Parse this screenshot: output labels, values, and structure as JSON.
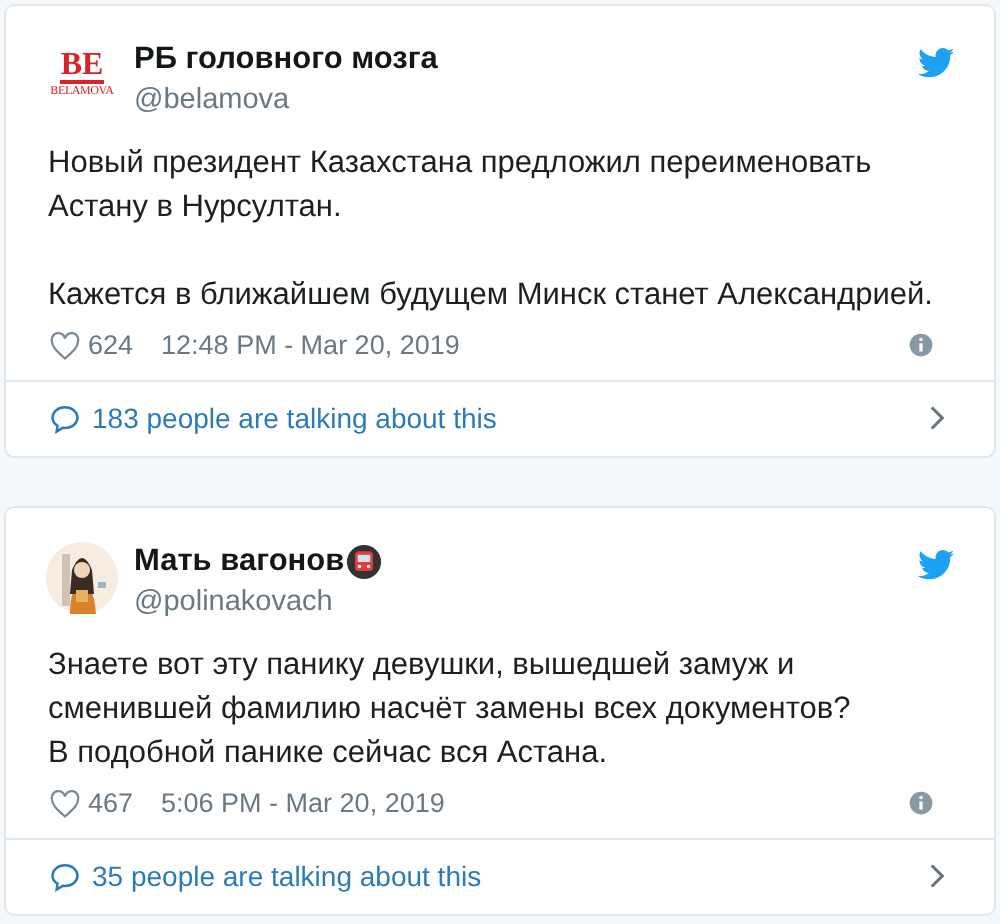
{
  "tweets": [
    {
      "avatar": {
        "kind": "logo",
        "text_top": "BE",
        "text_bottom": "BELAMOVA"
      },
      "name": "РБ головного мозга",
      "name_badge": false,
      "handle": "@belamova",
      "paragraphs": [
        "Новый президент Казахстана предложил переименовать\nАстану в Нурсултан.",
        "Кажется в ближайшем будущем Минск станет Александрией."
      ],
      "likes": "624",
      "time": "12:48 PM - Mar 20, 2019",
      "talking": "183 people are talking about this"
    },
    {
      "avatar": {
        "kind": "picture"
      },
      "name": "Мать вагонов",
      "name_badge": true,
      "handle": "@polinakovach",
      "paragraphs": [
        "Знаете вот эту панику девушки, вышедшей замуж и\nсменившей фамилию насчёт замены всех документов?\nВ подобной панике сейчас вся Астана."
      ],
      "likes": "467",
      "time": "5:06 PM - Mar 20, 2019",
      "talking": "35 people are talking about this"
    }
  ]
}
